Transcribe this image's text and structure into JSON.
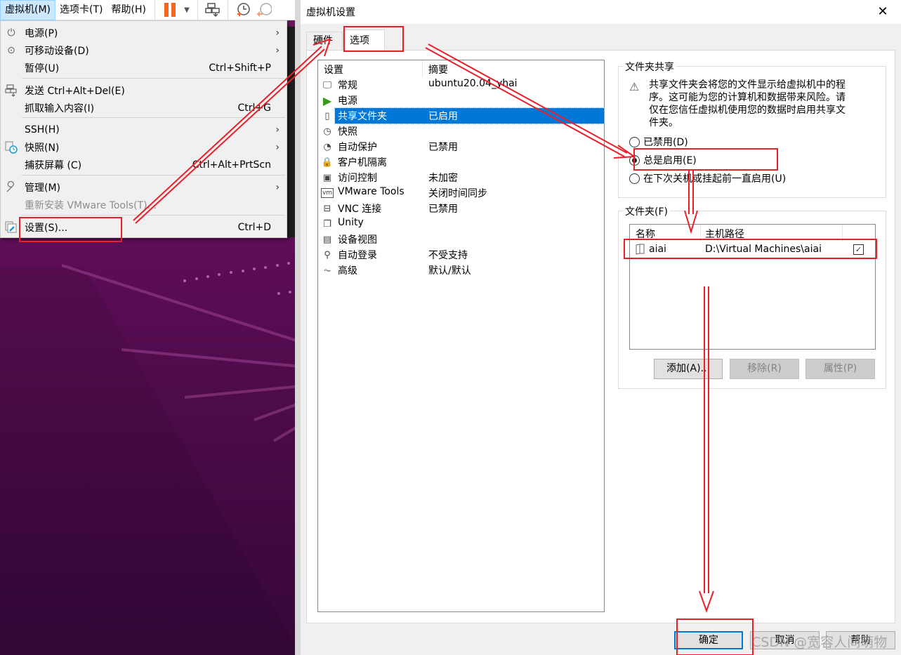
{
  "menubar": {
    "items": [
      {
        "label": "虚拟机(M)",
        "active": true
      },
      {
        "label": "选项卡(T)",
        "active": false
      },
      {
        "label": "帮助(H)",
        "active": false
      }
    ],
    "toolbar_icons": [
      "pause-icon",
      "dropdown-arrow-icon",
      "send-ctrl-alt-del-icon",
      "snapshot-take-icon",
      "snapshot-revert-icon"
    ],
    "pause_color": "#f26722"
  },
  "vm_menu": {
    "items": [
      {
        "icon": "power-icon",
        "label": "电源(P)",
        "shortcut": "",
        "submenu": true,
        "disabled": false
      },
      {
        "icon": "removable-device-icon",
        "label": "可移动设备(D)",
        "shortcut": "",
        "submenu": true,
        "disabled": false
      },
      {
        "icon": "",
        "label": "暂停(U)",
        "shortcut": "Ctrl+Shift+P",
        "submenu": false,
        "disabled": false
      },
      {
        "icon": "send-keys-icon",
        "label": "发送 Ctrl+Alt+Del(E)",
        "shortcut": "",
        "submenu": false,
        "disabled": false
      },
      {
        "icon": "",
        "label": "抓取输入内容(I)",
        "shortcut": "Ctrl+G",
        "submenu": false,
        "disabled": false
      },
      {
        "icon": "",
        "label": "SSH(H)",
        "shortcut": "",
        "submenu": true,
        "disabled": false
      },
      {
        "icon": "snapshot-icon",
        "label": "快照(N)",
        "shortcut": "",
        "submenu": true,
        "disabled": false
      },
      {
        "icon": "",
        "label": "捕获屏幕 (C)",
        "shortcut": "Ctrl+Alt+PrtScn",
        "submenu": false,
        "disabled": false
      },
      {
        "icon": "wrench-icon",
        "label": "管理(M)",
        "shortcut": "",
        "submenu": true,
        "disabled": false
      },
      {
        "icon": "",
        "label": "重新安装 VMware Tools(T)...",
        "shortcut": "",
        "submenu": false,
        "disabled": true
      },
      {
        "icon": "settings-icon",
        "label": "设置(S)...",
        "shortcut": "Ctrl+D",
        "submenu": false,
        "disabled": false
      }
    ],
    "submenu_arrow": "›"
  },
  "dialog": {
    "title": "虚拟机设置",
    "close_glyph": "✕",
    "tabs": [
      {
        "label": "硬件",
        "active": false
      },
      {
        "label": "选项",
        "active": true
      }
    ],
    "settings_list": {
      "columns": [
        "设置",
        "摘要"
      ],
      "rows": [
        {
          "icon": "monitor-icon",
          "name": "常规",
          "summary": "ubuntu20.04_yhai",
          "selected": false
        },
        {
          "icon": "power-play-icon",
          "name": "电源",
          "summary": "",
          "selected": false
        },
        {
          "icon": "shared-folder-icon",
          "name": "共享文件夹",
          "summary": "已启用",
          "selected": true
        },
        {
          "icon": "snapshot-icon",
          "name": "快照",
          "summary": "",
          "selected": false
        },
        {
          "icon": "autoprotect-clock-icon",
          "name": "自动保护",
          "summary": "已禁用",
          "selected": false
        },
        {
          "icon": "lock-icon",
          "name": "客户机隔离",
          "summary": "",
          "selected": false
        },
        {
          "icon": "access-control-icon",
          "name": "访问控制",
          "summary": "未加密",
          "selected": false
        },
        {
          "icon": "vmware-tools-icon",
          "name": "VMware Tools",
          "summary": "关闭时间同步",
          "selected": false
        },
        {
          "icon": "vnc-icon",
          "name": "VNC 连接",
          "summary": "已禁用",
          "selected": false
        },
        {
          "icon": "unity-icon",
          "name": "Unity",
          "summary": "",
          "selected": false
        },
        {
          "icon": "device-view-icon",
          "name": "设备视图",
          "summary": "",
          "selected": false
        },
        {
          "icon": "autologin-icon",
          "name": "自动登录",
          "summary": "不受支持",
          "selected": false
        },
        {
          "icon": "advanced-icon",
          "name": "高级",
          "summary": "默认/默认",
          "selected": false
        }
      ]
    },
    "folder_sharing": {
      "title": "文件夹共享",
      "warning": "共享文件夹会将您的文件显示给虚拟机中的程序。这可能为您的计算机和数据带来风险。请仅在您信任虚拟机使用您的数据时启用共享文件夹。",
      "options": [
        {
          "label": "已禁用(D)",
          "checked": false
        },
        {
          "label": "总是启用(E)",
          "checked": true
        },
        {
          "label": "在下次关机或挂起前一直启用(U)",
          "checked": false
        }
      ]
    },
    "folders": {
      "title": "文件夹(F)",
      "columns": [
        "名称",
        "主机路径"
      ],
      "rows": [
        {
          "name": "aiai",
          "host_path": "D:\\Virtual Machines\\aiai",
          "enabled": true
        }
      ],
      "check_glyph": "✓",
      "buttons": {
        "add": "添加(A)...",
        "remove": "移除(R)",
        "properties": "属性(P)"
      }
    },
    "footer": {
      "ok": "确定",
      "cancel": "取消",
      "help": "帮助"
    }
  },
  "watermark": "CSDN @宽容人间萌物",
  "annotation_color": "#e8202a"
}
